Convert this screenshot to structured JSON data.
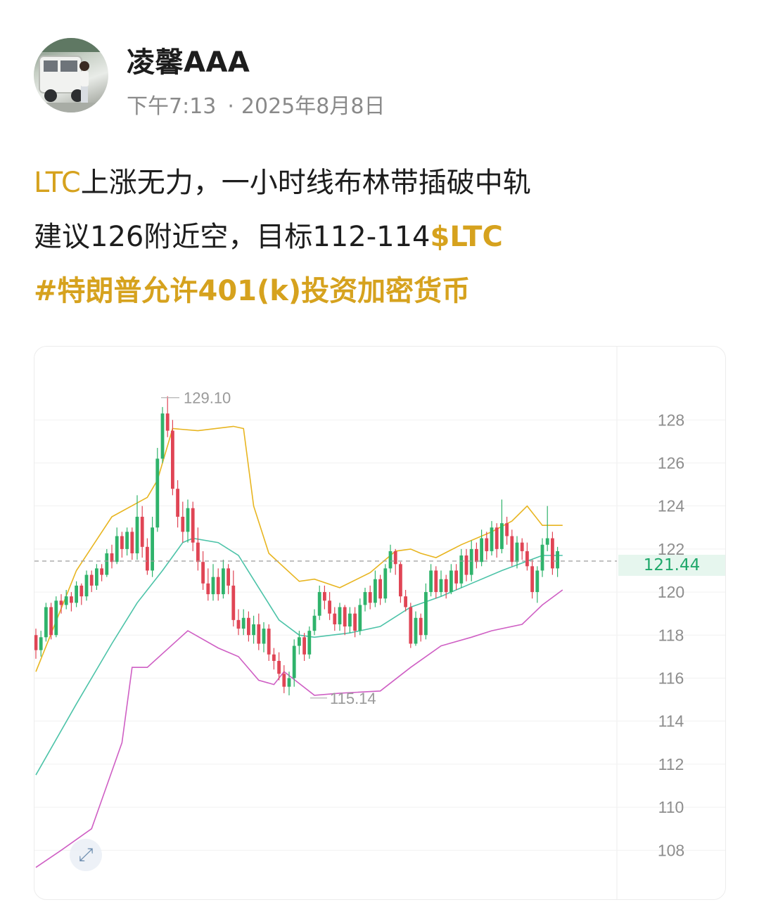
{
  "author": {
    "name": "凌馨AAA",
    "time": "下午7:13",
    "separator": "·",
    "date": "2025年8月8日"
  },
  "post": {
    "line1_symbol": "LTC",
    "line1_text": "上涨无力，一小时线布林带插破中轨",
    "line2_text": "建议126附近空，目标112-114",
    "line2_cashtag": "$LTC",
    "hashtag": "#特朗普允许401(k)投资加密货币"
  },
  "colors": {
    "accent_gold": "#d6a21e",
    "up_candle": "#2fb36b",
    "down_candle": "#e04555",
    "upper_band": "#e8b520",
    "middle_band": "#4cc3a8",
    "lower_band": "#cf5fc4"
  },
  "icons": {
    "expand": "expand-diagonal-icon"
  },
  "chart_data": {
    "type": "candlestick",
    "symbol": "LTC",
    "timeframe": "1h",
    "indicators": [
      "Bollinger Bands"
    ],
    "ylim": [
      107,
      131
    ],
    "y_ticks": [
      128,
      126,
      124,
      122,
      120,
      118,
      116,
      114,
      112,
      110,
      108
    ],
    "current_price": "121.44",
    "high_label": "129.10",
    "low_label": "115.14",
    "candles": [
      [
        118,
        117.3,
        118.3,
        116.9
      ],
      [
        117.3,
        117.9,
        118.2,
        117.0
      ],
      [
        117.9,
        119.3,
        119.5,
        117.7
      ],
      [
        119.3,
        118.0,
        119.5,
        117.8
      ],
      [
        118.0,
        119.6,
        119.8,
        117.9
      ],
      [
        119.6,
        119.4,
        119.9,
        119.0
      ],
      [
        119.4,
        119.8,
        120.1,
        119.2
      ],
      [
        119.8,
        119.5,
        120.0,
        119.1
      ],
      [
        119.5,
        120.3,
        120.5,
        119.3
      ],
      [
        120.3,
        119.8,
        120.4,
        119.4
      ],
      [
        119.8,
        120.8,
        121.0,
        119.6
      ],
      [
        120.8,
        120.3,
        121.0,
        120.0
      ],
      [
        120.3,
        121.1,
        121.3,
        120.1
      ],
      [
        121.1,
        120.8,
        121.3,
        120.5
      ],
      [
        120.8,
        121.8,
        122.0,
        120.7
      ],
      [
        121.8,
        121.4,
        122.2,
        121.1
      ],
      [
        121.4,
        122.6,
        123.0,
        121.3
      ],
      [
        122.6,
        122.0,
        122.8,
        121.6
      ],
      [
        122.0,
        122.8,
        123.0,
        121.7
      ],
      [
        122.8,
        121.8,
        123.0,
        121.5
      ],
      [
        121.8,
        123.5,
        124.5,
        121.5
      ],
      [
        123.5,
        122.1,
        124.0,
        121.6
      ],
      [
        122.1,
        121.0,
        122.5,
        120.8
      ],
      [
        121.0,
        123.0,
        123.5,
        120.7
      ],
      [
        123.0,
        126.2,
        126.7,
        122.8
      ],
      [
        126.2,
        128.3,
        128.6,
        126.0
      ],
      [
        128.3,
        127.5,
        129.1,
        127.2
      ],
      [
        127.5,
        124.8,
        128.0,
        124.5
      ],
      [
        124.8,
        123.5,
        125.2,
        123.0
      ],
      [
        123.5,
        122.8,
        124.2,
        122.3
      ],
      [
        122.8,
        123.9,
        124.3,
        122.3
      ],
      [
        123.9,
        122.3,
        124.2,
        121.9
      ],
      [
        122.3,
        121.4,
        123.0,
        121.0
      ],
      [
        121.4,
        120.4,
        121.9,
        120.1
      ],
      [
        120.4,
        119.9,
        121.1,
        119.6
      ],
      [
        119.9,
        120.7,
        121.3,
        119.6
      ],
      [
        120.7,
        119.9,
        121.1,
        119.6
      ],
      [
        119.9,
        121.1,
        121.5,
        119.7
      ],
      [
        121.1,
        120.3,
        121.3,
        119.9
      ],
      [
        120.3,
        118.7,
        121.0,
        118.4
      ],
      [
        118.7,
        118.3,
        119.2,
        118.0
      ],
      [
        118.3,
        118.8,
        119.2,
        118.0
      ],
      [
        118.8,
        118.0,
        119.1,
        117.7
      ],
      [
        118.0,
        118.5,
        118.9,
        117.6
      ],
      [
        118.5,
        117.6,
        119.0,
        117.3
      ],
      [
        117.6,
        118.3,
        118.6,
        117.2
      ],
      [
        118.3,
        117.1,
        118.5,
        116.8
      ],
      [
        117.1,
        116.8,
        117.4,
        116.4
      ],
      [
        116.8,
        116.2,
        117.2,
        115.9
      ],
      [
        116.2,
        115.6,
        116.6,
        115.3
      ],
      [
        115.6,
        116.0,
        116.3,
        115.2
      ],
      [
        116.0,
        117.5,
        117.8,
        115.6
      ],
      [
        117.5,
        117.9,
        118.2,
        117.1
      ],
      [
        117.9,
        117.1,
        118.1,
        116.8
      ],
      [
        117.1,
        118.2,
        118.4,
        116.9
      ],
      [
        118.2,
        118.9,
        119.2,
        118.0
      ],
      [
        118.9,
        120.0,
        120.3,
        118.7
      ],
      [
        120.0,
        119.6,
        120.3,
        119.2
      ],
      [
        119.6,
        119.0,
        120.0,
        118.7
      ],
      [
        119.0,
        118.5,
        119.3,
        118.2
      ],
      [
        118.5,
        119.3,
        119.5,
        118.2
      ],
      [
        119.3,
        118.4,
        119.4,
        118.0
      ],
      [
        118.4,
        119.0,
        119.3,
        118.1
      ],
      [
        119.0,
        118.2,
        119.3,
        117.9
      ],
      [
        118.2,
        119.4,
        119.7,
        118.0
      ],
      [
        119.4,
        120.0,
        120.2,
        119.1
      ],
      [
        120.0,
        119.5,
        120.3,
        119.2
      ],
      [
        119.5,
        120.6,
        121.0,
        119.3
      ],
      [
        120.6,
        119.7,
        120.8,
        119.4
      ],
      [
        119.7,
        121.1,
        121.3,
        119.5
      ],
      [
        121.1,
        121.9,
        122.2,
        120.9
      ],
      [
        121.9,
        121.3,
        122.0,
        120.8
      ],
      [
        121.3,
        119.8,
        121.4,
        119.5
      ],
      [
        119.8,
        119.3,
        120.1,
        119.1
      ],
      [
        119.3,
        117.6,
        119.5,
        117.4
      ],
      [
        117.6,
        118.8,
        119.1,
        117.5
      ],
      [
        118.8,
        118.0,
        119.0,
        117.7
      ],
      [
        118.0,
        120.0,
        120.4,
        117.8
      ],
      [
        120.0,
        121.0,
        121.3,
        119.8
      ],
      [
        121.0,
        120.0,
        121.2,
        119.7
      ],
      [
        120.0,
        120.6,
        121.0,
        119.8
      ],
      [
        120.6,
        120.0,
        120.8,
        119.7
      ],
      [
        120.0,
        121.0,
        121.3,
        119.9
      ],
      [
        121.0,
        120.4,
        121.3,
        120.1
      ],
      [
        120.4,
        121.7,
        122.0,
        120.2
      ],
      [
        121.7,
        120.8,
        122.0,
        120.5
      ],
      [
        120.8,
        122.0,
        122.4,
        120.5
      ],
      [
        122.0,
        121.4,
        122.3,
        121.1
      ],
      [
        121.4,
        122.5,
        122.9,
        121.2
      ],
      [
        122.5,
        121.9,
        122.8,
        121.5
      ],
      [
        121.9,
        123.0,
        123.3,
        121.7
      ],
      [
        123.0,
        122.0,
        123.2,
        121.6
      ],
      [
        122.0,
        123.2,
        124.3,
        121.8
      ],
      [
        123.2,
        122.6,
        123.5,
        122.2
      ],
      [
        122.6,
        121.4,
        122.9,
        121.2
      ],
      [
        121.4,
        122.3,
        122.6,
        121.1
      ],
      [
        122.3,
        121.9,
        122.5,
        121.5
      ],
      [
        121.9,
        121.2,
        122.3,
        121.0
      ],
      [
        121.2,
        120.0,
        121.5,
        119.7
      ],
      [
        120.0,
        121.0,
        121.2,
        119.5
      ],
      [
        121.0,
        122.2,
        122.5,
        120.7
      ],
      [
        122.2,
        122.5,
        124.0,
        121.9
      ],
      [
        122.5,
        121.1,
        122.8,
        120.8
      ],
      [
        121.1,
        121.9,
        122.1,
        120.7
      ]
    ],
    "bands": {
      "upper": [
        [
          0,
          116.3
        ],
        [
          8,
          121.0
        ],
        [
          15,
          123.5
        ],
        [
          22,
          124.4
        ],
        [
          24,
          125.2
        ],
        [
          27,
          127.6
        ],
        [
          32,
          127.5
        ],
        [
          39,
          127.7
        ],
        [
          41,
          127.6
        ],
        [
          43,
          124.0
        ],
        [
          46,
          121.8
        ],
        [
          52,
          120.5
        ],
        [
          55,
          120.6
        ],
        [
          60,
          120.2
        ],
        [
          66,
          120.9
        ],
        [
          71,
          121.9
        ],
        [
          74,
          122.0
        ],
        [
          76,
          121.8
        ],
        [
          79,
          121.6
        ],
        [
          84,
          122.2
        ],
        [
          90,
          122.8
        ],
        [
          94,
          123.3
        ],
        [
          97,
          124.0
        ],
        [
          100,
          123.1
        ],
        [
          104,
          123.1
        ]
      ],
      "middle": [
        [
          0,
          111.5
        ],
        [
          8,
          114.8
        ],
        [
          15,
          117.6
        ],
        [
          20,
          119.5
        ],
        [
          25,
          121.0
        ],
        [
          29,
          122.3
        ],
        [
          31,
          122.5
        ],
        [
          36,
          122.3
        ],
        [
          40,
          121.7
        ],
        [
          44,
          120.2
        ],
        [
          48,
          118.7
        ],
        [
          52,
          118.0
        ],
        [
          55,
          117.9
        ],
        [
          62,
          118.1
        ],
        [
          68,
          118.4
        ],
        [
          74,
          119.3
        ],
        [
          80,
          119.8
        ],
        [
          86,
          120.4
        ],
        [
          92,
          121.0
        ],
        [
          100,
          121.7
        ],
        [
          104,
          121.7
        ]
      ],
      "lower": [
        [
          0,
          107.2
        ],
        [
          5,
          108.0
        ],
        [
          11,
          109.0
        ],
        [
          17,
          113.0
        ],
        [
          19,
          116.5
        ],
        [
          22,
          116.5
        ],
        [
          30,
          118.2
        ],
        [
          36,
          117.4
        ],
        [
          40,
          117.0
        ],
        [
          44,
          115.9
        ],
        [
          47,
          115.7
        ],
        [
          49,
          116.3
        ],
        [
          55,
          115.2
        ],
        [
          60,
          115.3
        ],
        [
          68,
          115.4
        ],
        [
          74,
          116.5
        ],
        [
          80,
          117.5
        ],
        [
          86,
          117.9
        ],
        [
          90,
          118.2
        ],
        [
          96,
          118.5
        ],
        [
          100,
          119.4
        ],
        [
          104,
          120.1
        ]
      ]
    }
  }
}
